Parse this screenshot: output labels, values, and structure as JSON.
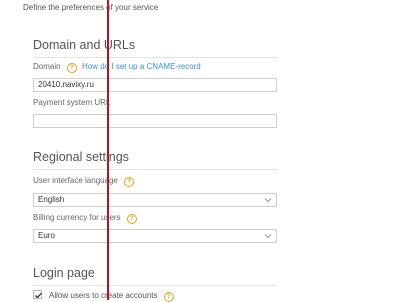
{
  "intro": "Define the preferences of your service",
  "domain_section": {
    "title": "Domain and URLs",
    "domain_label": "Domain",
    "domain_help_link": "How do I set up a CNAME-record",
    "domain_value": "20410.navixy.ru",
    "payment_label": "Payment system URL",
    "payment_value": ""
  },
  "regional_section": {
    "title": "Regional settings",
    "language_label": "User interface language",
    "language_value": "English",
    "currency_label": "Billing currency for users",
    "currency_value": "Euro"
  },
  "login_section": {
    "title": "Login page",
    "allow_accounts_label": "Allow users to create accounts",
    "allow_accounts_checked": true
  },
  "icons": {
    "help": "help-circle-icon",
    "chevron": "chevron-down-icon",
    "check": "checkmark-icon"
  },
  "colors": {
    "accent_link": "#3a8fd8",
    "help_icon": "#f0a020",
    "overlay_line": "#c0101a"
  }
}
